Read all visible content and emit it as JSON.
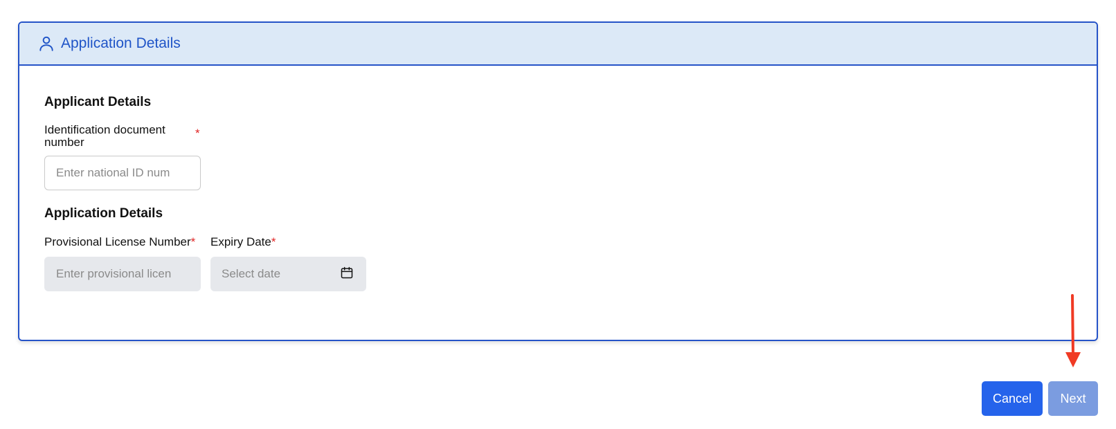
{
  "card": {
    "header_title": "Application Details",
    "header_icon": "user-icon"
  },
  "applicant": {
    "section_title": "Applicant Details",
    "id_label": "Identification document number",
    "id_required": "*",
    "id_placeholder": "Enter national ID num"
  },
  "application": {
    "section_title": "Application Details",
    "license_label": "Provisional License Number",
    "license_required": "*",
    "license_placeholder": "Enter provisional licen",
    "expiry_label": "Expiry Date",
    "expiry_required": "*",
    "expiry_placeholder": "Select date",
    "expiry_icon": "calendar-icon"
  },
  "actions": {
    "cancel_label": "Cancel",
    "next_label": "Next"
  },
  "colors": {
    "primary": "#2563eb",
    "primary_disabled": "#7b9ce0",
    "header_bg": "#dce9f7",
    "border": "#2553c8",
    "required": "#e02424",
    "annotation_arrow": "#f03a24"
  }
}
